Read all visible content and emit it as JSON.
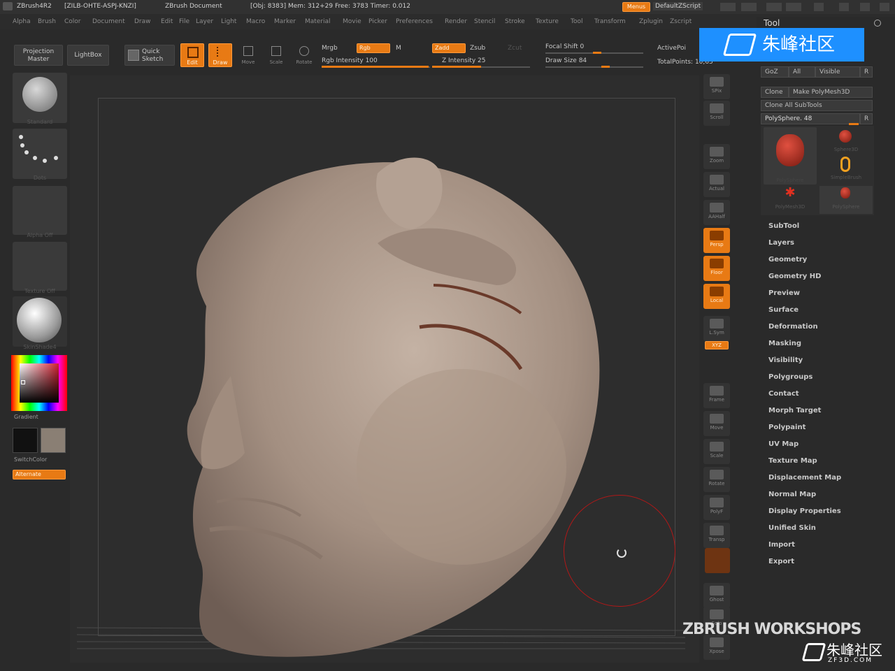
{
  "title": {
    "app": "ZBrush4R2",
    "serial": "[ZILB-OHTE-ASPJ-KNZI]",
    "document": "ZBrush Document",
    "stats": "[Obj: 8383] Mem: 312+29 Free: 3783 Timer: 0.012",
    "menus_button": "Menus",
    "script": "DefaultZScript"
  },
  "menubar": [
    "Alpha",
    "Brush",
    "Color",
    "Document",
    "Draw",
    "Edit",
    "File",
    "Layer",
    "Light",
    "Macro",
    "Marker",
    "Material",
    "Movie",
    "Picker",
    "Preferences",
    "Render",
    "Stencil",
    "Stroke",
    "Texture",
    "Tool",
    "Transform",
    "Zplugin",
    "Zscript"
  ],
  "toolbar": {
    "projection_master": "Projection Master",
    "lightbox": "LightBox",
    "quick_sketch": "Quick Sketch",
    "edit": "Edit",
    "draw": "Draw",
    "move": "Move",
    "scale": "Scale",
    "rotate": "Rotate",
    "mrgb": "Mrgb",
    "rgb": "Rgb",
    "m": "M",
    "rgb_intensity": "Rgb Intensity 100",
    "zadd": "Zadd",
    "zsub": "Zsub",
    "zcut": "Zcut",
    "z_intensity": "Z Intensity 25",
    "focal_shift": "Focal Shift 0",
    "draw_size": "Draw Size 84",
    "active_points": "ActivePoi",
    "total_points": "TotalPoints: 10,65"
  },
  "left_shelf": {
    "brush_label": "Standard",
    "stroke_label": "Dots",
    "alpha_label": "Alpha Off",
    "texture_label": "Texture Off",
    "material_label": "SkinShade4",
    "gradient_label": "Gradient",
    "switchcolor_label": "SwitchColor",
    "alternate_label": "Alternate"
  },
  "right_shelf": [
    "SPix",
    "Scroll",
    "Zoom",
    "Actual",
    "AAHalf",
    "Persp",
    "Floor",
    "Local",
    "L.Sym",
    "Frame",
    "Move",
    "Scale",
    "Rotate",
    "PolyF",
    "Transp",
    "Ghost",
    "Solo",
    "Xpose"
  ],
  "right_shelf_xyz": "XYZ",
  "tool_panel": {
    "title": "Tool",
    "goz": "GoZ",
    "all": "All",
    "visible": "Visible",
    "r": "R",
    "clone": "Clone",
    "make_polymesh": "Make PolyMesh3D",
    "clone_all": "Clone All SubTools",
    "current": "PolySphere. 48",
    "tools": [
      "PolySphere",
      "Sphere3D",
      "SimpleBrush",
      "PolyMesh3D",
      "PolySphere"
    ],
    "sections": [
      "SubTool",
      "Layers",
      "Geometry",
      "Geometry HD",
      "Preview",
      "Surface",
      "Deformation",
      "Masking",
      "Visibility",
      "Polygroups",
      "Contact",
      "Morph Target",
      "Polypaint",
      "UV Map",
      "Texture Map",
      "Displacement Map",
      "Normal Map",
      "Display Properties",
      "Unified Skin",
      "Import",
      "Export"
    ]
  },
  "watermarks": {
    "top_right": "朱峰社区",
    "workshops": "ZBRUSH WORKSHOPS",
    "bottom_right": "朱峰社区",
    "bottom_url": "ZF3D.COM"
  },
  "colors": {
    "accent": "#e87a14",
    "panel": "#2a2a2a",
    "watermark_blue": "#1e90ff"
  }
}
